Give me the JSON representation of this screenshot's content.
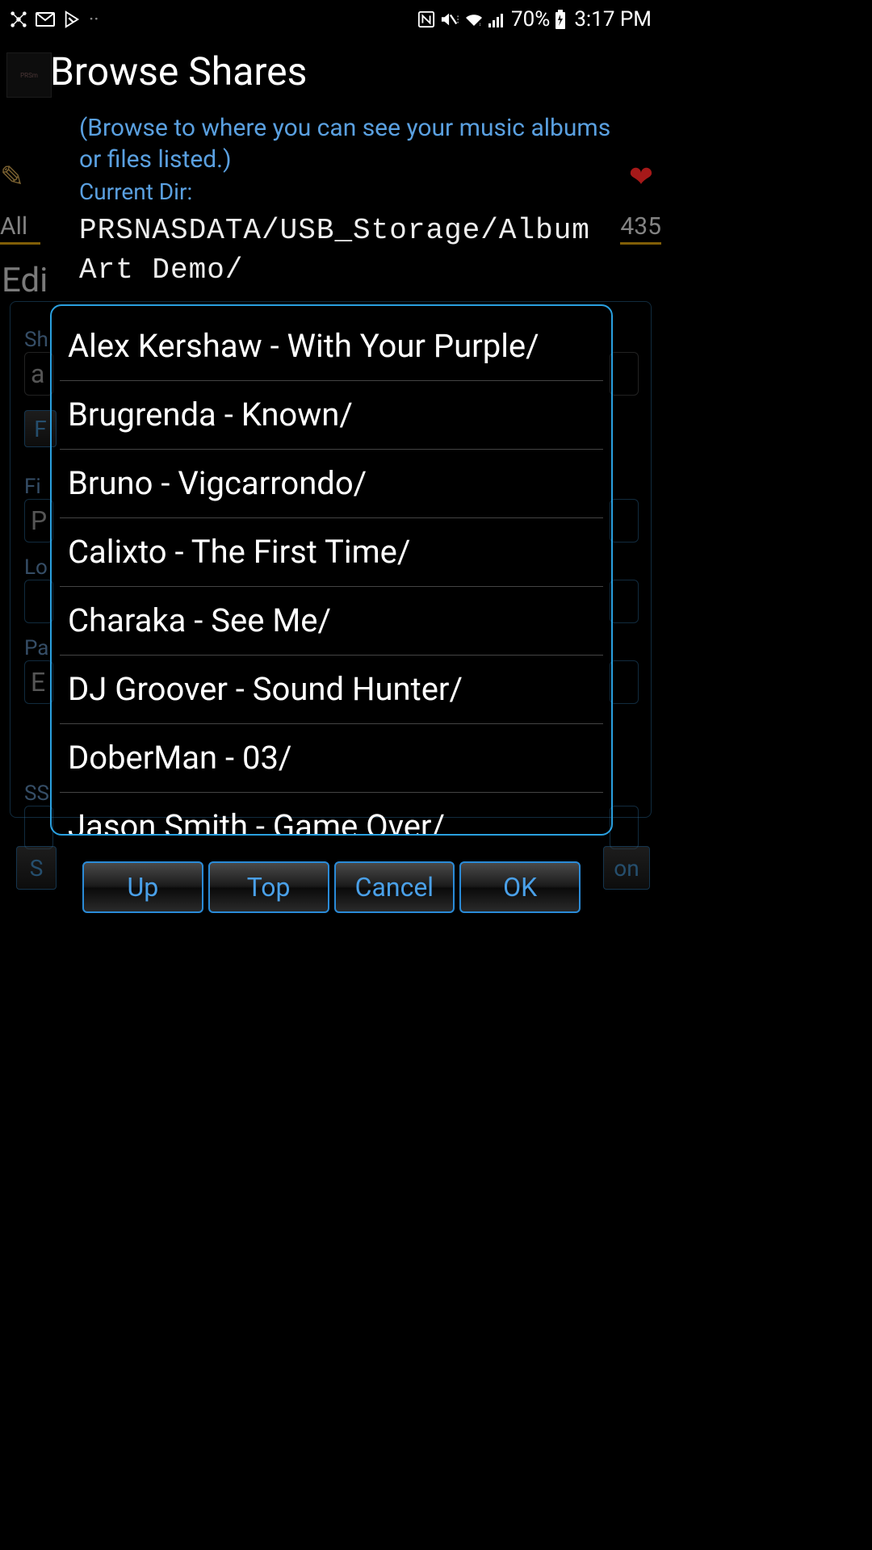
{
  "status": {
    "battery": "70%",
    "time": "3:17 PM"
  },
  "background": {
    "all_label": "All",
    "count": "435",
    "edit_label": "Edi",
    "labels": {
      "sh": "Sh",
      "fi": "Fi",
      "lo": "Lo",
      "pa": "Pa",
      "ss": "SS"
    },
    "values": {
      "a": "a",
      "p": "P",
      "e": "E",
      "f": "F",
      "s": "S",
      "on": "on"
    }
  },
  "dialog": {
    "title": "Browse Shares",
    "hint": "(Browse to where you can see your music albums or files listed.)",
    "current_dir_label": "Current Dir:",
    "current_dir_path": "PRSNASDATA/USB_Storage/Album Art Demo/",
    "files": [
      "Alex Kershaw - With Your Purple/",
      "Brugrenda - Known/",
      "Bruno - Vigcarrondo/",
      "Calixto - The First Time/",
      "Charaka - See Me/",
      "DJ Groover - Sound Hunter/",
      "DoberMan - 03/",
      "Jason Smith - Game Over/"
    ],
    "buttons": {
      "up": "Up",
      "top": "Top",
      "cancel": "Cancel",
      "ok": "OK"
    }
  }
}
